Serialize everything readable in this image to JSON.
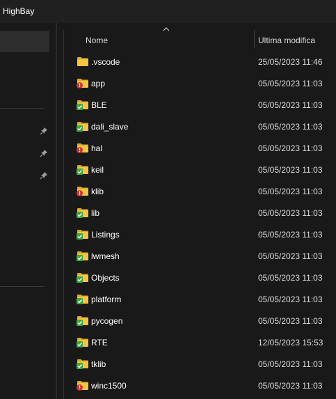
{
  "window": {
    "title": "HighBay"
  },
  "header": {
    "col_name": "Nome",
    "col_modified": "Ultima modifica",
    "sort_indicator": "chevron-up-icon"
  },
  "colors": {
    "background": "#191919",
    "folder": "#f4c542",
    "folder_dark": "#d9a827",
    "badge_ok": "#3fa742",
    "badge_error": "#d13438"
  },
  "files": [
    {
      "name": ".vscode",
      "modified": "25/05/2023 11:46",
      "status": "none"
    },
    {
      "name": "app",
      "modified": "05/05/2023 11:03",
      "status": "error"
    },
    {
      "name": "BLE",
      "modified": "05/05/2023 11:03",
      "status": "ok"
    },
    {
      "name": "dali_slave",
      "modified": "05/05/2023 11:03",
      "status": "ok"
    },
    {
      "name": "hal",
      "modified": "05/05/2023 11:03",
      "status": "error"
    },
    {
      "name": "keil",
      "modified": "05/05/2023 11:03",
      "status": "ok"
    },
    {
      "name": "klib",
      "modified": "05/05/2023 11:03",
      "status": "error"
    },
    {
      "name": "lib",
      "modified": "05/05/2023 11:03",
      "status": "ok"
    },
    {
      "name": "Listings",
      "modified": "05/05/2023 11:03",
      "status": "ok"
    },
    {
      "name": "lwmesh",
      "modified": "05/05/2023 11:03",
      "status": "ok"
    },
    {
      "name": "Objects",
      "modified": "05/05/2023 11:03",
      "status": "ok"
    },
    {
      "name": "platform",
      "modified": "05/05/2023 11:03",
      "status": "ok"
    },
    {
      "name": "pycogen",
      "modified": "05/05/2023 11:03",
      "status": "ok"
    },
    {
      "name": "RTE",
      "modified": "12/05/2023 15:53",
      "status": "ok"
    },
    {
      "name": "tklib",
      "modified": "05/05/2023 11:03",
      "status": "ok"
    },
    {
      "name": "winc1500",
      "modified": "05/05/2023 11:03",
      "status": "error"
    }
  ]
}
